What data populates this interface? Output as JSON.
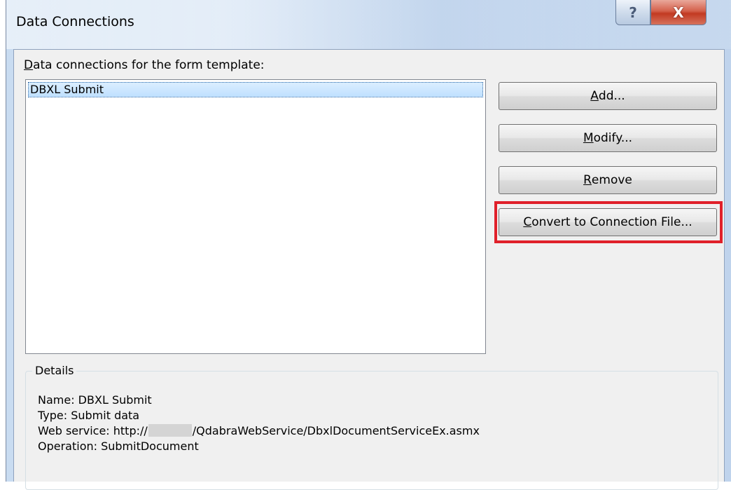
{
  "window": {
    "title": "Data Connections",
    "help_glyph": "?",
    "close_glyph": "X"
  },
  "connections": {
    "label_accel": "D",
    "label_rest": "ata connections for the form template:",
    "items": [
      "DBXL Submit"
    ],
    "selected": "DBXL Submit"
  },
  "buttons": {
    "add": {
      "accel": "A",
      "rest": "dd..."
    },
    "modify": {
      "accel": "M",
      "rest": "odify..."
    },
    "remove": {
      "accel": "R",
      "rest": "emove"
    },
    "convert": {
      "accel": "C",
      "rest": "onvert to Connection File..."
    }
  },
  "details": {
    "group_title": "Details",
    "name": "Name: DBXL Submit",
    "type": "Type: Submit data",
    "web_service_prefix": "Web service: http://",
    "web_service_suffix": "/QdabraWebService/DbxlDocumentServiceEx.asmx",
    "operation": "Operation: SubmitDocument"
  },
  "colors": {
    "highlight": "#e0202a",
    "selection": "#bfe0ff"
  }
}
